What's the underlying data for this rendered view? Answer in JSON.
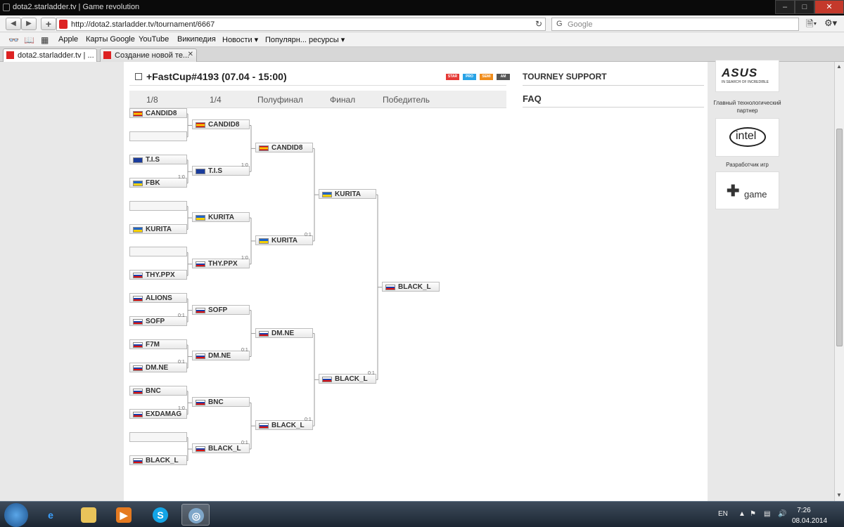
{
  "window": {
    "title": "dota2.starladder.tv | Game revolution",
    "controls": [
      "–",
      "□",
      "✕"
    ]
  },
  "toolbar": {
    "url": "http://dota2.starladder.tv/tournament/6667",
    "search_placeholder": "Google",
    "search_engine_letter": "G"
  },
  "bookmarks": [
    "Apple",
    "Карты Google",
    "YouTube",
    "Википедия",
    "Новости ▾",
    "Популярн... ресурсы ▾"
  ],
  "tabs": [
    {
      "label": "dota2.starladder.tv | ...",
      "active": true
    },
    {
      "label": "Создание новой те...",
      "active": false
    }
  ],
  "tournament": {
    "title": "+FastCup#4193 (07.04 - 15:00)",
    "badges": [
      {
        "label": "STAR",
        "color": "#e53935"
      },
      {
        "label": "PRO",
        "color": "#29a3e6"
      },
      {
        "label": "SEMI",
        "color": "#f08c1a"
      },
      {
        "label": "AM",
        "color": "#555555"
      }
    ],
    "rounds": [
      "1/8",
      "1/4",
      "Полуфинал",
      "Финал",
      "Победитель"
    ]
  },
  "side": {
    "support": "TOURNEY SUPPORT",
    "faq": "FAQ"
  },
  "bracket": {
    "r1": [
      [
        "es",
        "CANDID8"
      ],
      [
        "",
        ""
      ],
      [
        "eu",
        "T.I.S"
      ],
      [
        "ua",
        "FBK"
      ],
      [
        "",
        ""
      ],
      [
        "ua",
        "KURITA"
      ],
      [
        "",
        ""
      ],
      [
        "ru",
        "THY.PPX"
      ],
      [
        "ru",
        "ALIONS"
      ],
      [
        "ru",
        "SOFP"
      ],
      [
        "ru",
        "F7M"
      ],
      [
        "ru",
        "DM.NE"
      ],
      [
        "ru",
        "BNC"
      ],
      [
        "ru",
        "EXDAMAG"
      ],
      [
        "",
        ""
      ],
      [
        "ru",
        "BLACK_L"
      ]
    ],
    "r1_scores": [
      "",
      "1:0",
      "",
      "",
      "0:1",
      "0:1",
      "1:0",
      ""
    ],
    "r2": [
      [
        "es",
        "CANDID8"
      ],
      [
        "eu",
        "T.I.S"
      ],
      [
        "ua",
        "KURITA"
      ],
      [
        "ru",
        "THY.PPX"
      ],
      [
        "ru",
        "SOFP"
      ],
      [
        "ru",
        "DM.NE"
      ],
      [
        "ru",
        "BNC"
      ],
      [
        "ru",
        "BLACK_L"
      ]
    ],
    "r2_scores": [
      "1:0",
      "1:0",
      "0:1",
      "0:1"
    ],
    "r3": [
      [
        "es",
        "CANDID8"
      ],
      [
        "ua",
        "KURITA"
      ],
      [
        "ru",
        "DM.NE"
      ],
      [
        "ru",
        "BLACK_L"
      ]
    ],
    "r3_scores": [
      "0:1",
      "0:1"
    ],
    "r4": [
      [
        "ua",
        "KURITA"
      ],
      [
        "ru",
        "BLACK_L"
      ]
    ],
    "r4_scores": [
      "0:1"
    ],
    "winner": [
      "ru",
      "BLACK_L"
    ]
  },
  "sponsors": {
    "asus_logo": "ASUS",
    "asus_tagline": "IN SEARCH OF INCREDIBLE",
    "asus_caption": "Главный технологический партнер",
    "intel_logo": "intel",
    "intel_caption": "Разработчик игр",
    "game_logo": "game"
  },
  "taskbar": {
    "lang": "EN",
    "time": "7:26",
    "date": "08.04.2014"
  }
}
